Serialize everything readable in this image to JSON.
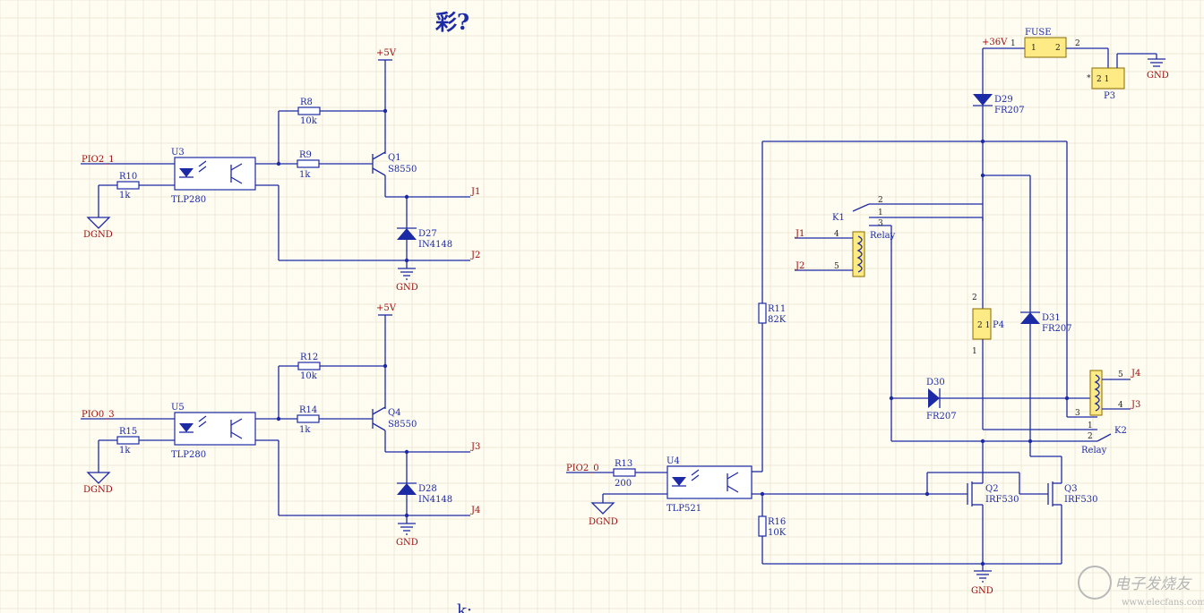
{
  "header": {
    "title": "彩?",
    "bottom_fragment": "k:"
  },
  "watermark": {
    "text": "电子发烧友",
    "url": "www.elecfans.com"
  },
  "ch1": {
    "net_in": "PIO2_1",
    "vcc": "+5V",
    "gnd_digital": "DGND",
    "gnd": "GND",
    "out_a": "J1",
    "out_b": "J2",
    "opto": {
      "ref": "U3",
      "part": "TLP280"
    },
    "r_in": {
      "ref": "R10",
      "val": "1k"
    },
    "r_pull": {
      "ref": "R8",
      "val": "10k"
    },
    "r_base": {
      "ref": "R9",
      "val": "1k"
    },
    "transistor": {
      "ref": "Q1",
      "part": "S8550"
    },
    "diode": {
      "ref": "D27",
      "part": "IN4148"
    }
  },
  "ch2": {
    "net_in": "PIO0_3",
    "vcc": "+5V",
    "gnd_digital": "DGND",
    "gnd": "GND",
    "out_a": "J3",
    "out_b": "J4",
    "opto": {
      "ref": "U5",
      "part": "TLP280"
    },
    "r_in": {
      "ref": "R15",
      "val": "1k"
    },
    "r_pull": {
      "ref": "R12",
      "val": "10k"
    },
    "r_base": {
      "ref": "R14",
      "val": "1k"
    },
    "transistor": {
      "ref": "Q4",
      "part": "S8550"
    },
    "diode": {
      "ref": "D28",
      "part": "IN4148"
    }
  },
  "right": {
    "vin": "+36V",
    "gnd": "GND",
    "gnd_digital": "DGND",
    "net_in": "PIO2_0",
    "fuse": {
      "ref": "FUSE",
      "pin1": "1",
      "pin2": "2",
      "wire1": "1",
      "wire2": "2"
    },
    "p3": {
      "ref": "P3",
      "pins": "2  1",
      "mark": "*"
    },
    "d29": {
      "ref": "D29",
      "part": "FR207"
    },
    "d30": {
      "ref": "D30",
      "part": "FR207"
    },
    "d31": {
      "ref": "D31",
      "part": "FR207"
    },
    "k1": {
      "ref": "K1",
      "part": "Relay",
      "pin1": "1",
      "pin2": "2",
      "pin3": "3",
      "pin4": "4",
      "pin5": "5",
      "coil_a": "J1",
      "coil_b": "J2"
    },
    "k2": {
      "ref": "K2",
      "part": "Relay",
      "pin1": "1",
      "pin2": "2",
      "pin3": "3",
      "pin4": "4",
      "pin5": "5",
      "coil_a": "J4",
      "coil_b": "J3"
    },
    "p4": {
      "ref": "P4",
      "pin_a": "2",
      "pin_b": "1",
      "body": "2 1"
    },
    "r11": {
      "ref": "R11",
      "val": "82K"
    },
    "r13": {
      "ref": "R13",
      "val": "200"
    },
    "r16": {
      "ref": "R16",
      "val": "10K"
    },
    "u4": {
      "ref": "U4",
      "part": "TLP521"
    },
    "q2": {
      "ref": "Q2",
      "part": "IRF530"
    },
    "q3": {
      "ref": "Q3",
      "part": "IRF530"
    }
  },
  "colors": {
    "wire": "#1c2aa6",
    "net_label": "#9e0a0a",
    "component_fill": "#ffeb85",
    "sheet": "#fffdf2"
  }
}
